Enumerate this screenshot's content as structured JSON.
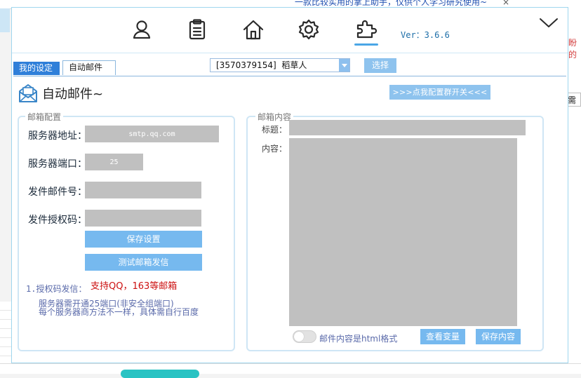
{
  "background": {
    "title_fragment": "一款比较实用的掌上助手，仅供个人学习研究使用~",
    "close_glyph": "×",
    "right_red_text": "盼的",
    "right_box_text": "需"
  },
  "nav": {
    "icons": [
      "user-icon",
      "clipboard-icon",
      "home-icon",
      "gear-icon",
      "puzzle-icon"
    ],
    "active": "puzzle-icon",
    "version": "Ver：3.6.6",
    "collapse_icon": "chevron-down-icon"
  },
  "tabs": [
    "我的设定",
    "自动邮件"
  ],
  "account": {
    "selected": "[3570379154]  稻草人",
    "button": "选择"
  },
  "page": {
    "title": "自动邮件~",
    "group_button": ">>>点我配置群开关<<<"
  },
  "mail_config": {
    "legend": "邮箱配置",
    "server_label": "服务器地址：",
    "server_value": "smtp.qq.com",
    "port_label": "服务器端口：",
    "port_value": "25",
    "sender_label": "发件邮件号：",
    "sender_value": "",
    "auth_label": "发件授权码：",
    "auth_value": "",
    "save_button": "保存设置",
    "test_button": "测试邮箱发信",
    "support_text": "支持QQ，163等邮箱",
    "tip_title": "1.授权码发信：",
    "tip_line1": "服务器需开通25端口(非安全组端口)",
    "tip_line2": "每个服务器商方法不一样，具体需自行百度"
  },
  "mail_content": {
    "legend": "邮箱内容",
    "subject_label": "标题：",
    "subject_value": "",
    "body_label": "内容：",
    "body_value": "",
    "html_toggle_label": "邮件内容是html格式",
    "html_toggle_on": false,
    "view_vars_button": "查看变量",
    "save_content_button": "保存内容"
  },
  "colors": {
    "accent": "#2f7fd9",
    "button": "#76b9ef",
    "support_red": "#cc1010",
    "field_gray": "#c0c0c0"
  }
}
